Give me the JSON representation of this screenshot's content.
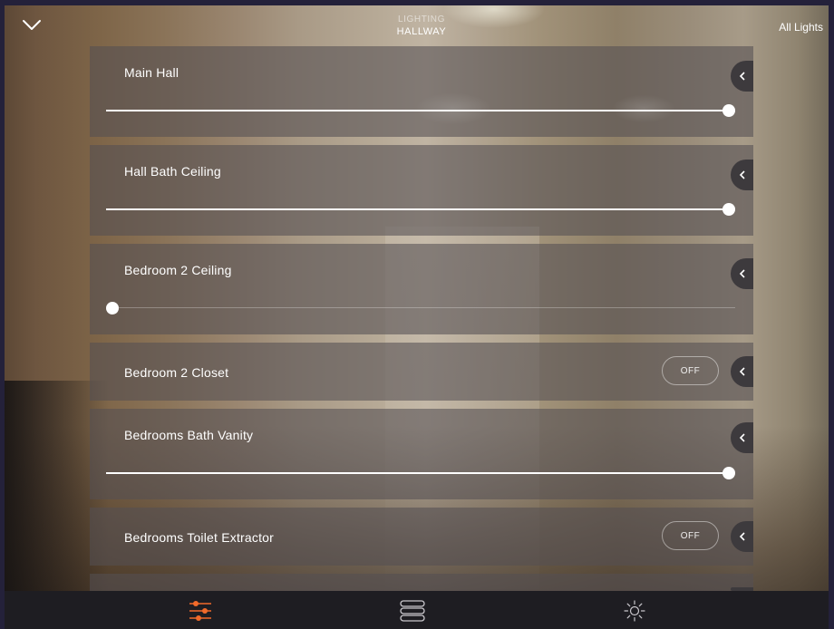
{
  "header": {
    "subtitle": "LIGHTING",
    "title": "HALLWAY",
    "all_lights_label": "All Lights"
  },
  "lights": [
    {
      "name": "Main Hall",
      "type": "dimmer",
      "level": 1.0
    },
    {
      "name": "Hall Bath Ceiling",
      "type": "dimmer",
      "level": 1.0
    },
    {
      "name": "Bedroom 2 Ceiling",
      "type": "dimmer",
      "level": 0.0
    },
    {
      "name": "Bedroom 2 Closet",
      "type": "switch",
      "state_label": "OFF"
    },
    {
      "name": "Bedrooms Bath Vanity",
      "type": "dimmer",
      "level": 1.0
    },
    {
      "name": "Bedrooms Toilet Extractor",
      "type": "switch",
      "state_label": "OFF"
    }
  ],
  "tabbar": {
    "tabs": [
      {
        "icon": "sliders-icon",
        "active": true
      },
      {
        "icon": "list-icon",
        "active": false
      },
      {
        "icon": "sun-icon",
        "active": false
      }
    ]
  },
  "colors": {
    "accent": "#f26a2a",
    "card": "#54504f",
    "tabbar": "#1e1d22"
  }
}
